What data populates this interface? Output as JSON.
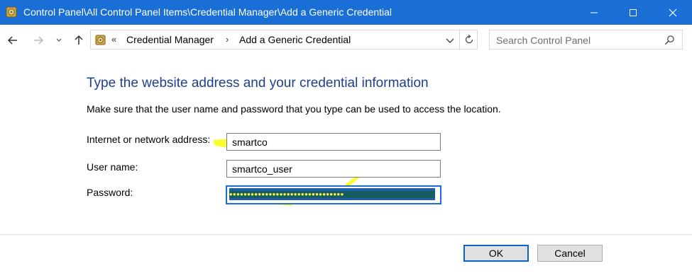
{
  "window": {
    "title": "Control Panel\\All Control Panel Items\\Credential Manager\\Add a Generic Credential",
    "controls": [
      "minimize",
      "maximize",
      "close"
    ]
  },
  "navigation": {
    "breadcrumb_prefix": "«",
    "breadcrumbs": [
      "Credential Manager",
      "Add a Generic Credential"
    ],
    "separator": "›",
    "search_placeholder": "Search Control Panel"
  },
  "form": {
    "heading": "Type the website address and your credential information",
    "description": "Make sure that the user name and password that you type can be used to access the location.",
    "fields": [
      {
        "label": "Internet or network address:",
        "value": "smartco"
      },
      {
        "label": "User name:",
        "value": "smartco_user"
      },
      {
        "label": "Password:",
        "value": "••••••••••••••••••••••••••••••••"
      }
    ]
  },
  "buttons": {
    "ok": "OK",
    "cancel": "Cancel"
  },
  "colors": {
    "titlebar": "#1a6fd6",
    "heading": "#1e3f8c",
    "highlight": "#fbfb2e",
    "focus_border": "#1a6fd6"
  }
}
